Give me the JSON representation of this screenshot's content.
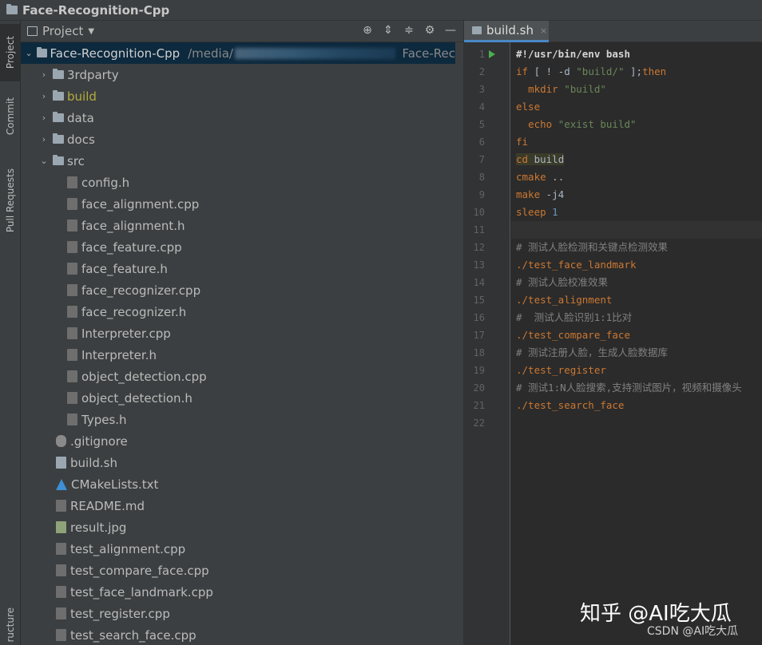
{
  "window": {
    "title": "Face-Recognition-Cpp"
  },
  "toolstrip": {
    "tabs": [
      "Project",
      "Commit",
      "Pull Requests",
      "ructure"
    ]
  },
  "project_panel": {
    "title": "Project",
    "toolbar_icons": [
      "locate-icon",
      "expand-all-icon",
      "collapse-all-icon",
      "gear-icon",
      "hide-icon"
    ],
    "root": {
      "name": "Face-Recognition-Cpp",
      "path": "/media/",
      "path_tail": "Face-Rec"
    },
    "tree": [
      {
        "name": "3rdparty",
        "kind": "folder",
        "depth": 1,
        "expanded": false
      },
      {
        "name": "build",
        "kind": "folder",
        "depth": 1,
        "expanded": false,
        "excluded": true
      },
      {
        "name": "data",
        "kind": "folder",
        "depth": 1,
        "expanded": false
      },
      {
        "name": "docs",
        "kind": "folder",
        "depth": 1,
        "expanded": false
      },
      {
        "name": "src",
        "kind": "folder",
        "depth": 1,
        "expanded": true
      },
      {
        "name": "config.h",
        "kind": "h",
        "depth": 2
      },
      {
        "name": "face_alignment.cpp",
        "kind": "cpp",
        "depth": 2
      },
      {
        "name": "face_alignment.h",
        "kind": "h",
        "depth": 2
      },
      {
        "name": "face_feature.cpp",
        "kind": "cpp",
        "depth": 2
      },
      {
        "name": "face_feature.h",
        "kind": "h",
        "depth": 2
      },
      {
        "name": "face_recognizer.cpp",
        "kind": "cpp",
        "depth": 2
      },
      {
        "name": "face_recognizer.h",
        "kind": "h",
        "depth": 2
      },
      {
        "name": "Interpreter.cpp",
        "kind": "cpp",
        "depth": 2
      },
      {
        "name": "Interpreter.h",
        "kind": "h",
        "depth": 2
      },
      {
        "name": "object_detection.cpp",
        "kind": "cpp",
        "depth": 2
      },
      {
        "name": "object_detection.h",
        "kind": "h",
        "depth": 2
      },
      {
        "name": "Types.h",
        "kind": "h",
        "depth": 2
      },
      {
        "name": ".gitignore",
        "kind": "git",
        "depth": 1
      },
      {
        "name": "build.sh",
        "kind": "sh",
        "depth": 1
      },
      {
        "name": "CMakeLists.txt",
        "kind": "cmake",
        "depth": 1
      },
      {
        "name": "README.md",
        "kind": "md",
        "depth": 1
      },
      {
        "name": "result.jpg",
        "kind": "jpg",
        "depth": 1
      },
      {
        "name": "test_alignment.cpp",
        "kind": "cpp",
        "depth": 1
      },
      {
        "name": "test_compare_face.cpp",
        "kind": "cpp",
        "depth": 1
      },
      {
        "name": "test_face_landmark.cpp",
        "kind": "cpp",
        "depth": 1
      },
      {
        "name": "test_register.cpp",
        "kind": "cpp",
        "depth": 1
      },
      {
        "name": "test_search_face.cpp",
        "kind": "cpp",
        "depth": 1
      }
    ]
  },
  "editor": {
    "tab": {
      "label": "build.sh",
      "close": "×"
    },
    "current_line": 11,
    "lines": [
      "#!/usr/bin/env bash",
      "if [ ! -d \"build/\" ];then",
      "  mkdir \"build\"",
      "else",
      "  echo \"exist build\"",
      "fi",
      "cd build",
      "cmake ..",
      "make -j4",
      "sleep 1",
      "",
      "# 测试人脸检测和关键点检测效果",
      "./test_face_landmark",
      "# 测试人脸校准效果",
      "./test_alignment",
      "#  测试人脸识别1:1比对",
      "./test_compare_face",
      "# 测试注册人脸，生成人脸数据库",
      "./test_register",
      "# 测试1:N人脸搜索,支持测试图片，视频和摄像头",
      "./test_search_face",
      ""
    ]
  },
  "watermark": {
    "main": "知乎 @AI吃大瓜",
    "sub": "CSDN @AI吃大瓜"
  }
}
